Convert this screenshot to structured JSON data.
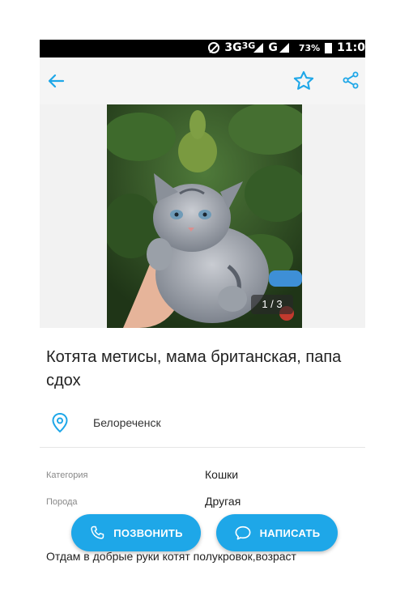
{
  "status_bar": {
    "network": "3G",
    "network_small": "3G",
    "network2": "G",
    "battery": "73%",
    "time": "11:0"
  },
  "app_bar": {
    "back_icon": "arrow-left-icon",
    "favorite_icon": "star-outline-icon",
    "share_icon": "share-icon"
  },
  "gallery": {
    "counter": "1 / 3"
  },
  "listing": {
    "title": "Котята метисы, мама британская, папа сдох",
    "location": "Белореченск",
    "details": [
      {
        "label": "Категория",
        "value": "Кошки"
      },
      {
        "label": "Порода",
        "value": "Другая"
      }
    ],
    "description": "Отдам в добрые руки котят полукровок,возраст"
  },
  "actions": {
    "call_label": "ПОЗВОНИТЬ",
    "write_label": "НАПИСАТЬ"
  },
  "colors": {
    "accent": "#1ea7e8",
    "status_bar": "#000000",
    "app_bar": "#f5f5f5"
  }
}
